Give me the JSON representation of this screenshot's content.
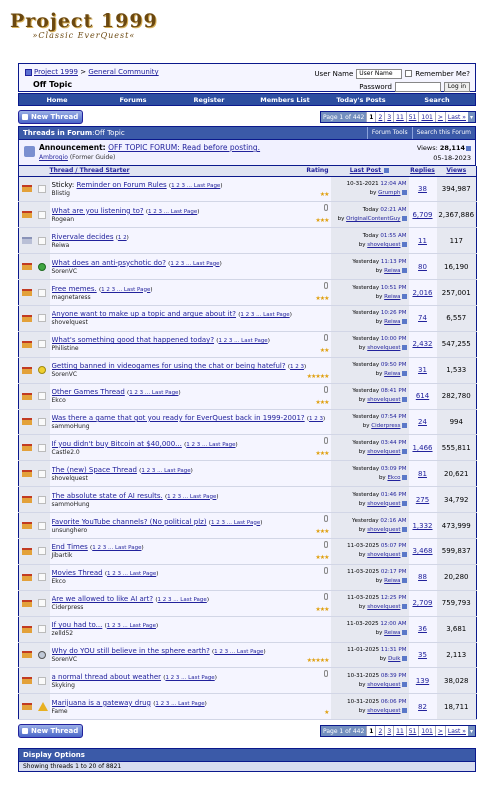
{
  "logo": {
    "line1": "Project 1999",
    "line2": "»Classic EverQuest«"
  },
  "breadcrumb": {
    "root": "Project 1999",
    "sep": " > ",
    "forum": "General Community",
    "current": "Off Topic"
  },
  "login": {
    "user_label": "User Name",
    "user_value": "User Name",
    "remember": "Remember Me?",
    "pass_label": "Password",
    "button": "Log in"
  },
  "navbar": [
    "Home",
    "Forums",
    "Register",
    "Members List",
    "Today's Posts",
    "Search"
  ],
  "new_thread": "New Thread",
  "pager": {
    "label": "Page 1 of 442",
    "pages": [
      "1",
      "2",
      "3",
      "11",
      "51",
      "101",
      ">",
      "Last »"
    ]
  },
  "forum_header": {
    "prefix": "Threads in Forum",
    "sep": " : ",
    "name": "Off Topic",
    "tools": "Forum Tools",
    "search": "Search this Forum"
  },
  "announcement": {
    "label": "Announcement:",
    "title": "OFF TOPIC FORUM: Read before posting.",
    "author": "Ambrogio",
    "author_role": "(Former Guide)",
    "views_label": "Views:",
    "views": "28,114",
    "date": "05-18-2023"
  },
  "columns": {
    "thread": "Thread",
    "sep": " / ",
    "starter": "Thread Starter",
    "rating": "Rating",
    "last": "Last Post",
    "replies": "Replies",
    "views": "Views"
  },
  "threads": [
    {
      "title": "Reminder on Forum Rules",
      "prefix": "Sticky: ",
      "pages": "1 2 3 ... Last Page",
      "starter": "Blistig",
      "date": "10-31-2021",
      "time": "12:04 AM",
      "by": "Grumph",
      "replies": "38",
      "views": "394,987",
      "stars": "★★",
      "fold": "",
      "icon": "blank",
      "clip": false
    },
    {
      "title": "What are you listening to?",
      "prefix": "",
      "pages": "1 2 3 ... Last Page",
      "starter": "Rogean",
      "date": "Today",
      "time": "02:21 AM",
      "by": "OriginalContentGuy",
      "replies": "6,709",
      "views": "2,367,886",
      "stars": "★★★",
      "fold": "",
      "icon": "blank",
      "clip": true
    },
    {
      "title": "Rivervale decides",
      "prefix": "",
      "pages": "1 2",
      "starter": "Reiwa",
      "date": "Today",
      "time": "01:55 AM",
      "by": "shovelquest",
      "replies": "11",
      "views": "117",
      "stars": "",
      "fold": "gray",
      "icon": "blank",
      "clip": false
    },
    {
      "title": "What does an anti-psychotic do?",
      "prefix": "",
      "pages": "1 2 3 ... Last Page",
      "starter": "SorenVC",
      "date": "Yesterday",
      "time": "11:13 PM",
      "by": "Reiwa",
      "replies": "80",
      "views": "16,190",
      "stars": "",
      "fold": "",
      "icon": "green",
      "clip": false
    },
    {
      "title": "Free memes.",
      "prefix": "",
      "pages": "1 2 3 ... Last Page",
      "starter": "magnetaress",
      "date": "Yesterday",
      "time": "10:51 PM",
      "by": "Reiwa",
      "replies": "2,016",
      "views": "257,001",
      "stars": "★★★",
      "fold": "",
      "icon": "blank",
      "clip": true
    },
    {
      "title": "Anyone want to make up a topic and argue about it?",
      "prefix": "",
      "pages": "1 2 3 ... Last Page",
      "starter": "shovelquest",
      "date": "Yesterday",
      "time": "10:26 PM",
      "by": "Reiwa",
      "replies": "74",
      "views": "6,557",
      "stars": "",
      "fold": "",
      "icon": "blank",
      "clip": false
    },
    {
      "title": "What's something good that happened today?",
      "prefix": "",
      "pages": "1 2 3 ... Last Page",
      "starter": "Philistine",
      "date": "Yesterday",
      "time": "10:00 PM",
      "by": "shovelquest",
      "replies": "2,432",
      "views": "547,255",
      "stars": "★★",
      "fold": "",
      "icon": "blank",
      "clip": true
    },
    {
      "title": "Getting banned in videogames for using the chat or being hateful?",
      "prefix": "",
      "pages": "1 2 3",
      "starter": "SorenVC",
      "date": "Yesterday",
      "time": "09:50 PM",
      "by": "Reiwa",
      "replies": "31",
      "views": "1,533",
      "stars": "★★★★★",
      "fold": "",
      "icon": "face",
      "clip": false
    },
    {
      "title": "Other Games Thread",
      "prefix": "",
      "pages": "1 2 3 ... Last Page",
      "starter": "Ekco",
      "date": "Yesterday",
      "time": "08:41 PM",
      "by": "shovelquest",
      "replies": "614",
      "views": "282,780",
      "stars": "★★★",
      "fold": "",
      "icon": "blank",
      "clip": true
    },
    {
      "title": "Was there a game that got you ready for EverQuest back in 1999-2001?",
      "prefix": "",
      "pages": "1 2 3",
      "starter": "sammoHung",
      "date": "Yesterday",
      "time": "07:54 PM",
      "by": "Ciderpress",
      "replies": "24",
      "views": "994",
      "stars": "",
      "fold": "",
      "icon": "blank",
      "clip": false
    },
    {
      "title": "If you didn't buy Bitcoin at $40,000...",
      "prefix": "",
      "pages": "1 2 3 ... Last Page",
      "starter": "Castle2.0",
      "date": "Yesterday",
      "time": "03:44 PM",
      "by": "shovelquest",
      "replies": "1,466",
      "views": "555,811",
      "stars": "★★★",
      "fold": "",
      "icon": "blank",
      "clip": true
    },
    {
      "title": "The (new) Space Thread",
      "prefix": "",
      "pages": "1 2 3 ... Last Page",
      "starter": "shovelquest",
      "date": "Yesterday",
      "time": "03:09 PM",
      "by": "Ekco",
      "replies": "81",
      "views": "20,621",
      "stars": "",
      "fold": "",
      "icon": "blank",
      "clip": false
    },
    {
      "title": "The absolute state of AI results.",
      "prefix": "",
      "pages": "1 2 3 ... Last Page",
      "starter": "sammoHung",
      "date": "Yesterday",
      "time": "01:46 PM",
      "by": "shovelquest",
      "replies": "275",
      "views": "34,792",
      "stars": "",
      "fold": "",
      "icon": "blank",
      "clip": false
    },
    {
      "title": "Favorite YouTube channels? (No political plz)",
      "prefix": "",
      "pages": "1 2 3 ... Last Page",
      "starter": "unsunghero",
      "date": "Yesterday",
      "time": "02:16 AM",
      "by": "shovelquest",
      "replies": "1,332",
      "views": "473,999",
      "stars": "★★★",
      "fold": "",
      "icon": "blank",
      "clip": true
    },
    {
      "title": "End Times",
      "prefix": "",
      "pages": "1 2 3 ... Last Page",
      "starter": "Jibartik",
      "date": "11-03-2025",
      "time": "05:07 PM",
      "by": "shovelquest",
      "replies": "3,468",
      "views": "599,837",
      "stars": "★★★",
      "fold": "",
      "icon": "blank",
      "clip": true
    },
    {
      "title": "Movies Thread",
      "prefix": "",
      "pages": "1 2 3 ... Last Page",
      "starter": "Ekco",
      "date": "11-03-2025",
      "time": "02:17 PM",
      "by": "Reiwa",
      "replies": "88",
      "views": "20,280",
      "stars": "",
      "fold": "",
      "icon": "blank",
      "clip": true
    },
    {
      "title": "Are we allowed to like AI art?",
      "prefix": "",
      "pages": "1 2 3 ... Last Page",
      "starter": "Ciderpress",
      "date": "11-03-2025",
      "time": "12:25 PM",
      "by": "shovelquest",
      "replies": "2,709",
      "views": "759,793",
      "stars": "★★★",
      "fold": "",
      "icon": "blank",
      "clip": true
    },
    {
      "title": "If you had to...",
      "prefix": "",
      "pages": "1 2 3 ... Last Page",
      "starter": "zelld52",
      "date": "11-03-2025",
      "time": "12:00 AM",
      "by": "Reiwa",
      "replies": "36",
      "views": "3,681",
      "stars": "",
      "fold": "",
      "icon": "blank",
      "clip": false
    },
    {
      "title": "Why do YOU still believe in the sphere earth?",
      "prefix": "",
      "pages": "1 2 3 ... Last Page",
      "starter": "SorenVC",
      "date": "11-01-2025",
      "time": "11:31 PM",
      "by": "Duik",
      "replies": "35",
      "views": "2,113",
      "stars": "★★★★★",
      "fold": "",
      "icon": "shade",
      "clip": false
    },
    {
      "title": "a normal thread about weather",
      "prefix": "",
      "pages": "1 2 3 ... Last Page",
      "starter": "Skyking",
      "date": "10-31-2025",
      "time": "08:39 PM",
      "by": "shovelquest",
      "replies": "139",
      "views": "38,028",
      "stars": "",
      "fold": "",
      "icon": "blank",
      "clip": true
    },
    {
      "title": "Marijuana is a gateway drug",
      "prefix": "",
      "pages": "1 2 3 ... Last Page",
      "starter": "Fame",
      "date": "10-31-2025",
      "time": "06:06 PM",
      "by": "shovelquest",
      "replies": "82",
      "views": "18,711",
      "stars": "★",
      "fold": "",
      "icon": "warn",
      "clip": false
    }
  ],
  "display_options": "Display Options",
  "display_sub": "Showing threads 1 to 20 of 8821"
}
